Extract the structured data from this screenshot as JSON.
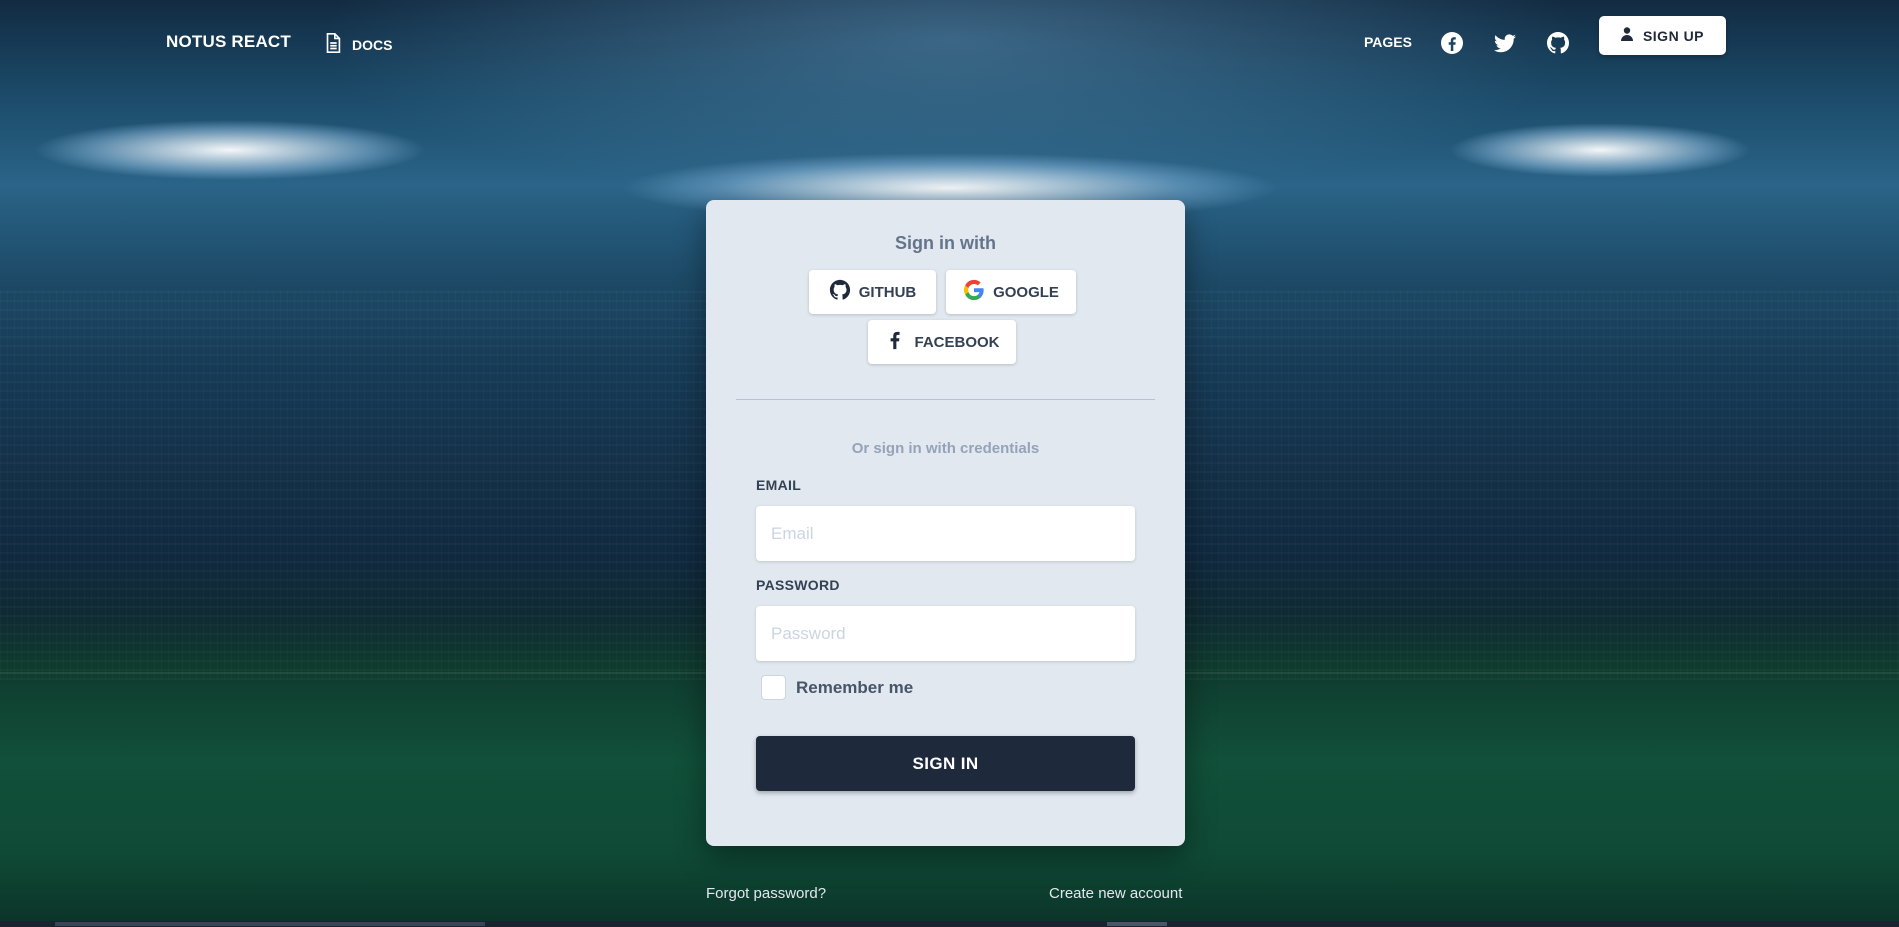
{
  "nav": {
    "brand": "NOTUS REACT",
    "docs_label": "DOCS",
    "pages_label": "PAGES",
    "signup_label": "SIGN UP",
    "icons": [
      "document-icon",
      "facebook-icon",
      "twitter-icon",
      "github-icon",
      "user-icon"
    ]
  },
  "card": {
    "sign_in_with": "Sign in with",
    "social_buttons": [
      {
        "label": "GITHUB",
        "icon": "github-icon"
      },
      {
        "label": "GOOGLE",
        "icon": "google-icon"
      },
      {
        "label": "FACEBOOK",
        "icon": "facebook-icon"
      }
    ],
    "or_text": "Or sign in with credentials",
    "email_label": "EMAIL",
    "email_placeholder": "Email",
    "email_value": "",
    "password_label": "PASSWORD",
    "password_placeholder": "Password",
    "password_value": "",
    "remember_label": "Remember me",
    "remember_checked": false,
    "signin_label": "SIGN IN"
  },
  "footer": {
    "forgot_password": "Forgot password?",
    "create_account": "Create new account"
  },
  "colors": {
    "card_bg": "#e2e8f0",
    "primary_button": "#1e293b",
    "muted_text": "#64748b"
  }
}
